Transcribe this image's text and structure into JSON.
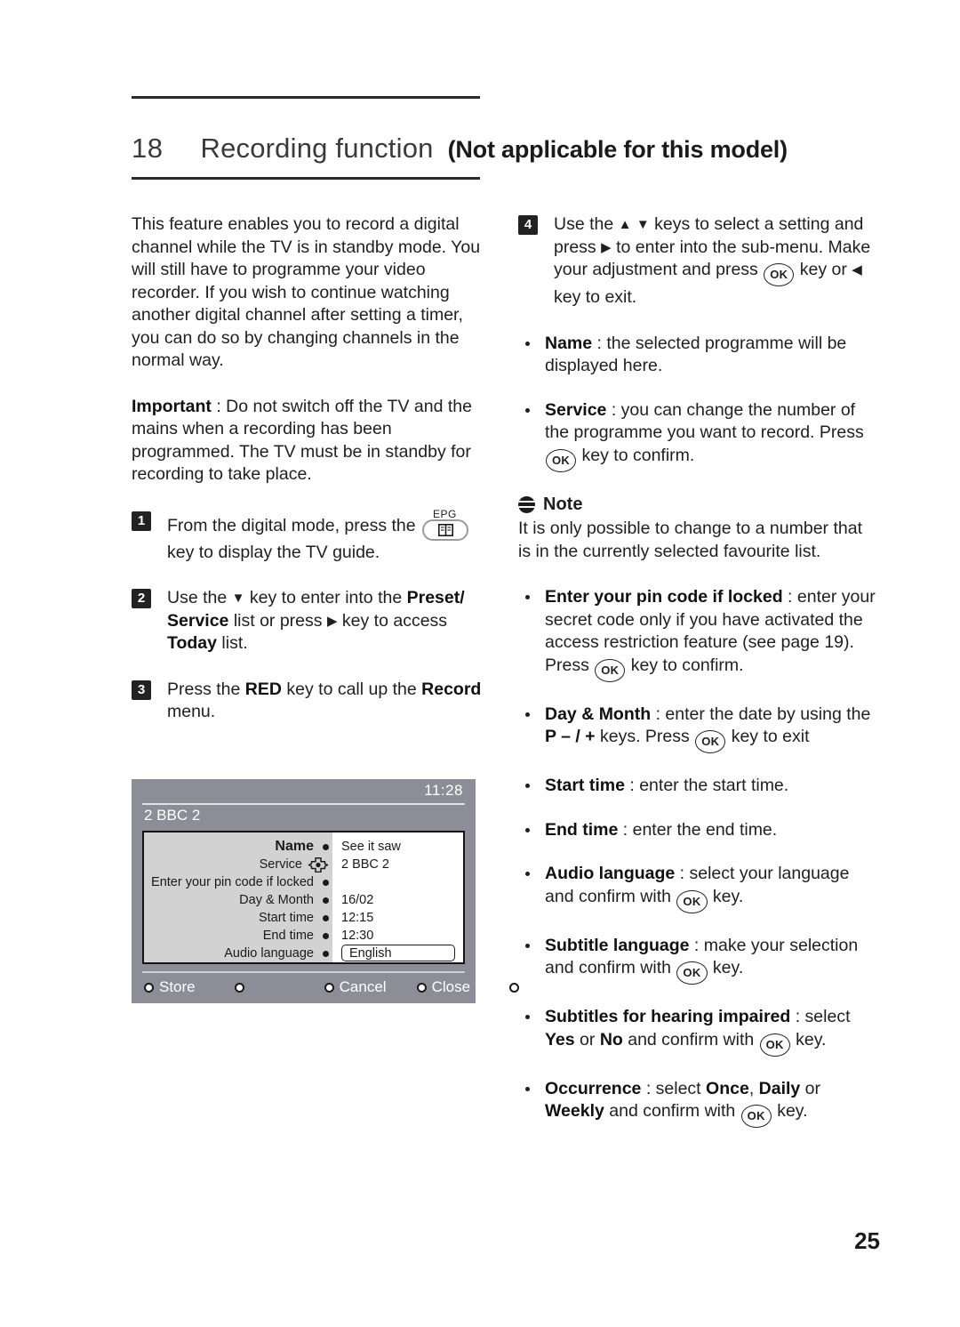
{
  "header": {
    "chapter_number": "18",
    "chapter_title": "Recording function",
    "chapter_note": "(Not applicable for this model)"
  },
  "left_column": {
    "intro_paragraph": "This feature enables you to record a digital channel while the TV is in standby mode. You will still have to programme your video recorder. If you wish to continue watching another digital channel after setting a timer, you can do so by changing channels in the normal way.",
    "important_label": "Important",
    "important_text": " : Do not switch off the TV and the mains when a recording has been programmed. The TV must be in standby for recording to take place.",
    "steps": [
      {
        "number": "1",
        "text_before": "From the digital mode, press the ",
        "key_label": "EPG",
        "text_after": " key to display the TV guide."
      },
      {
        "number": "2",
        "part1": " Use the ",
        "down_arrow": "▼",
        "part2": " key to enter into the ",
        "bold1": "Preset/ Service",
        "part3": " list or press ",
        "right_arrow": "▶",
        "part4": " key to access ",
        "bold2": "Today",
        "part5": " list."
      },
      {
        "number": "3",
        "part1": "Press the ",
        "bold1": "RED",
        "part2": " key to call up the ",
        "bold2": "Record",
        "part3": " menu."
      }
    ]
  },
  "tv_mockup": {
    "clock": "11:28",
    "channel": "2 BBC 2",
    "rows": [
      {
        "label": "Name",
        "bold": true,
        "marker": "dot",
        "value": "See it saw"
      },
      {
        "label": "Service",
        "bold": false,
        "marker": "dpad",
        "value": "2 BBC 2"
      },
      {
        "label": "Enter your pin code if locked",
        "bold": false,
        "marker": "dot",
        "value": ""
      },
      {
        "label": "Day & Month",
        "bold": false,
        "marker": "dot",
        "value": "16/02"
      },
      {
        "label": "Start time",
        "bold": false,
        "marker": "dot",
        "value": "12:15"
      },
      {
        "label": "End time",
        "bold": false,
        "marker": "dot",
        "value": "12:30"
      },
      {
        "label": "Audio language",
        "bold": false,
        "marker": "dot",
        "value": "English",
        "value_is_input": true
      }
    ],
    "buttons": [
      "Store",
      "",
      "Cancel",
      "Close",
      ""
    ]
  },
  "right_column": {
    "step4": {
      "number": "4",
      "part1": "Use the ",
      "up_arrow": "▲",
      "down_arrow": "▼",
      "part2": " keys to select a setting and press ",
      "right_arrow": "▶",
      "part3": " to enter into the sub-menu. Make your adjustment and press ",
      "ok_label": "OK",
      "part4": " key or ",
      "left_arrow": "◀",
      "part5": " key to exit."
    },
    "bullets": [
      {
        "bold": "Name",
        "text": " : the selected programme will be displayed here."
      },
      {
        "bold": "Service",
        "text_a": " : you can change the number of the programme you want to record. Press ",
        "ok_label": "OK",
        "text_b": " key to confirm."
      },
      {
        "bold": "Enter your pin code if locked",
        "text_a": " : enter your secret code only if you have activated the access restriction feature (see page 19). Press ",
        "ok_label": "OK",
        "text_b": " key to confirm."
      },
      {
        "bold": "Day & Month",
        "text_a": " : enter the date by using the ",
        "bold_key": "P  – / +",
        "text_b": " keys. Press ",
        "ok_label": "OK",
        "text_c": " key to exit"
      },
      {
        "bold": "Start time",
        "text": " : enter the start time."
      },
      {
        "bold": "End time",
        "text": " : enter the end time."
      },
      {
        "bold": "Audio language",
        "text_a": " : select your language and confirm with ",
        "ok_label": "OK",
        "text_b": " key."
      },
      {
        "bold": "Subtitle language",
        "text_a": " : make your selection and confirm with ",
        "ok_label": "OK",
        "text_b": " key."
      },
      {
        "bold": "Subtitles for hearing impaired",
        "text_a": " : select ",
        "bold_yes": "Yes",
        "text_b": " or ",
        "bold_no": "No",
        "text_c": " and confirm with ",
        "ok_label": "OK",
        "text_d": " key."
      },
      {
        "bold": "Occurrence",
        "text_a": " : select ",
        "bold_once": "Once",
        "text_b": ", ",
        "bold_daily": "Daily",
        "text_c": " or ",
        "bold_weekly": "Weekly",
        "text_d": " and confirm with ",
        "ok_label": "OK",
        "text_e": " key."
      }
    ],
    "note": {
      "title": "Note",
      "body": "It is only possible to change to a number that is in the currently selected favourite list."
    }
  },
  "page_number": "25"
}
